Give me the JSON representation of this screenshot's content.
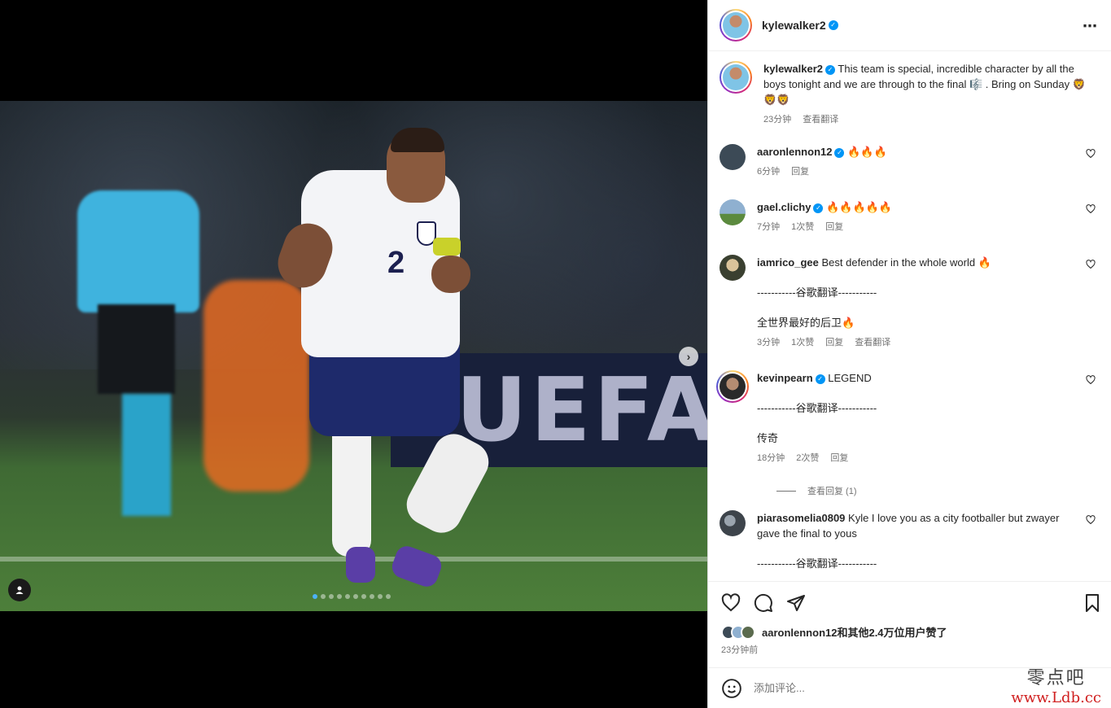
{
  "post": {
    "author": "kylewalker2",
    "caption": "This team is special, incredible character by all the boys tonight and we are through to the final 🎼 . Bring on Sunday 🦁🦁🦁",
    "caption_time": "23分钟",
    "caption_translate": "查看翻译",
    "media_dots": 10,
    "media_active_dot": 0
  },
  "comments": [
    {
      "user": "aaronlennon12",
      "verified": true,
      "text": "🔥🔥🔥",
      "time": "6分钟",
      "likes": "",
      "reply": "回复"
    },
    {
      "user": "gael.clichy",
      "verified": true,
      "text": "🔥🔥🔥🔥🔥",
      "time": "7分钟",
      "likes": "1次赞",
      "reply": "回复"
    },
    {
      "user": "iamrico_gee",
      "verified": false,
      "text": "Best defender in the whole world 🔥",
      "translation_header": "-----------谷歌翻译-----------",
      "translated": "全世界最好的后卫🔥",
      "time": "3分钟",
      "likes": "1次赞",
      "reply": "回复",
      "translate": "查看翻译"
    },
    {
      "user": "kevinpearn",
      "verified": true,
      "text": "LEGEND",
      "translation_header": "-----------谷歌翻译-----------",
      "translated": "传奇",
      "time": "18分钟",
      "likes": "2次赞",
      "reply": "回复",
      "view_replies": "查看回复 (1)"
    },
    {
      "user": "piarasomelia0809",
      "verified": false,
      "text": "Kyle I love you as a city footballer but zwayer gave the final to yous",
      "translation_header": "-----------谷歌翻译-----------"
    }
  ],
  "footer": {
    "likes_text": "aaronlennon12和其他2.4万位用户赞了",
    "post_time": "23分钟前",
    "comment_placeholder": "添加评论..."
  },
  "watermark": {
    "cn": "零点吧",
    "url": "www.Ldb.cc"
  },
  "colors": {
    "verified": "#0095f6",
    "link": "#737373",
    "active_dot": "#4cb1f7"
  }
}
